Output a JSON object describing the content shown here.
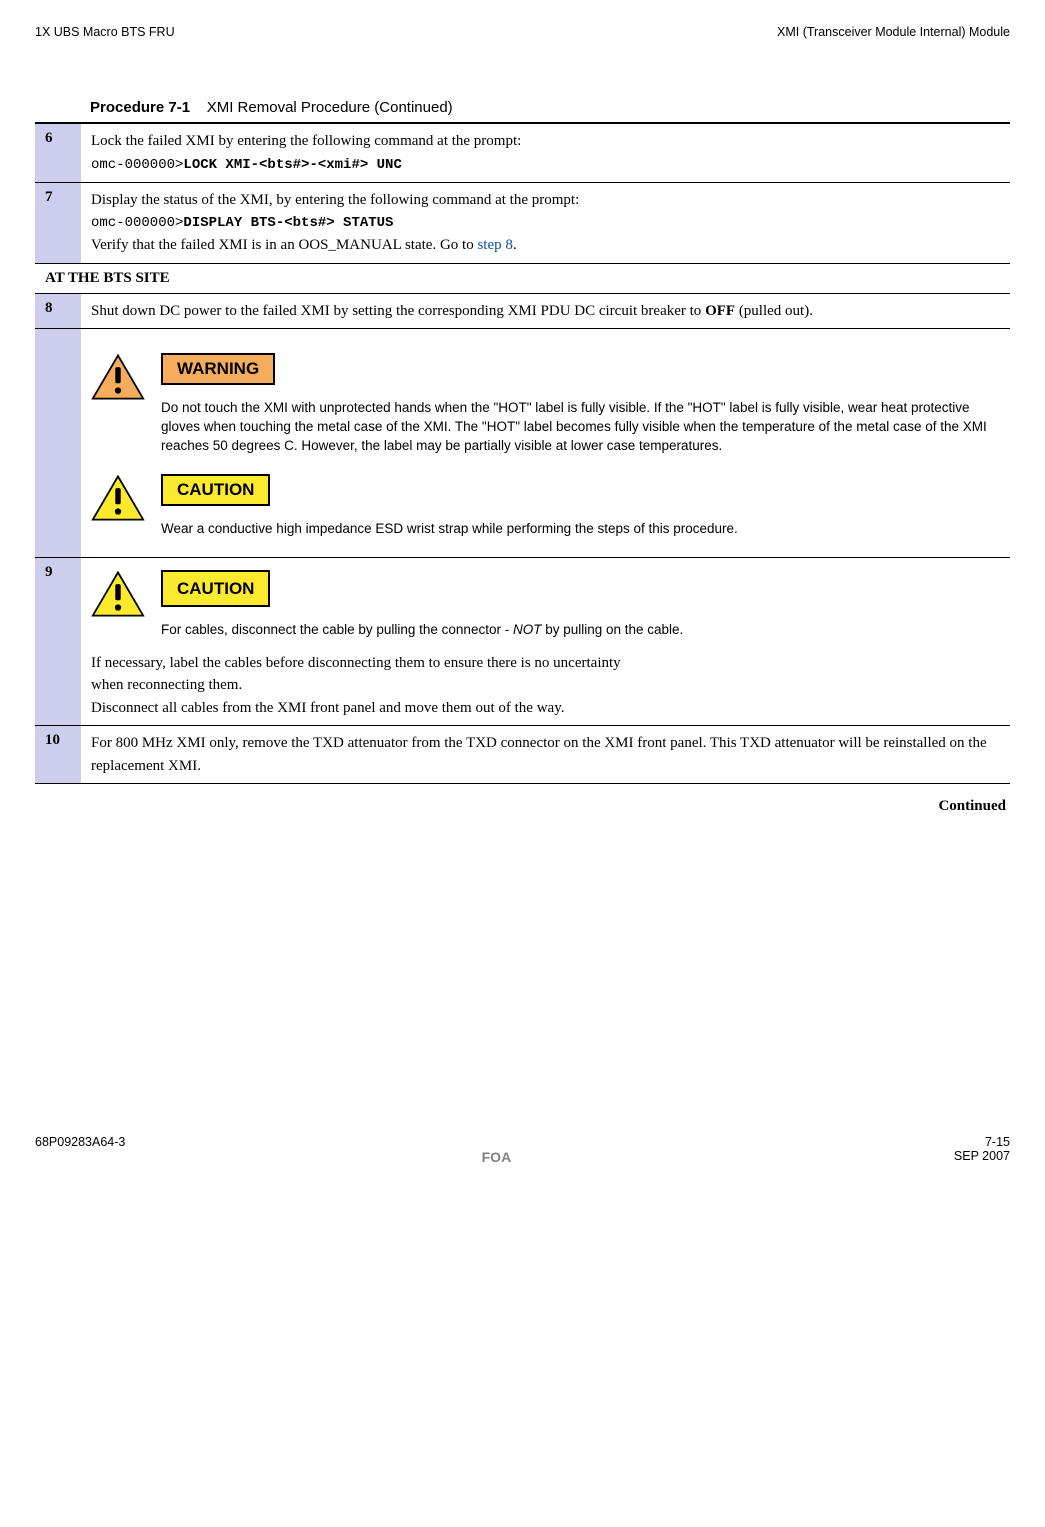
{
  "header": {
    "left": "1X UBS Macro BTS FRU",
    "right": "XMI (Transceiver Module Internal) Module"
  },
  "procedure": {
    "label": "Procedure 7-1",
    "title": "XMI Removal Procedure (Continued)"
  },
  "steps": {
    "s6": {
      "num": "6",
      "text1": "Lock the failed XMI by entering the following command at the prompt:",
      "prompt": "omc-000000>",
      "cmd": "LOCK XMI-<bts#>-<xmi#> UNC"
    },
    "s7": {
      "num": "7",
      "text1": "Display the status of the XMI, by entering the following command at the prompt:",
      "prompt": "omc-000000>",
      "cmd": "DISPLAY BTS-<bts#> STATUS",
      "text2a": "Verify that the failed XMI is in an OOS_MANUAL state.  Go to ",
      "link": "step 8",
      "text2b": "."
    },
    "section": "AT THE BTS SITE",
    "s8": {
      "num": "8",
      "text1a": "Shut down DC power to the failed XMI by setting the corresponding XMI PDU DC circuit breaker to ",
      "bold": "OFF",
      "text1b": " (pulled out)."
    },
    "warn1": {
      "label": "WARNING",
      "body": "Do not touch the XMI with unprotected hands when the \"HOT\" label is fully visible. If the \"HOT\" label is fully visible, wear heat protective gloves when touching the metal case of the XMI. The \"HOT\" label becomes fully visible when the temperature of the metal case of the XMI reaches 50 degrees C. However, the label may be partially visible at lower case temperatures."
    },
    "caution1": {
      "label": "CAUTION",
      "body": "Wear a conductive high impedance ESD wrist strap while performing the steps of this procedure."
    },
    "s9": {
      "num": "9",
      "caution_label": "CAUTION",
      "caution_body_a": "For cables, disconnect the cable by pulling the connector - ",
      "caution_body_em": "NOT",
      "caution_body_b": " by pulling on the cable.",
      "para1": "If necessary, label the cables before disconnecting them to ensure there is no uncertainty when reconnecting them.",
      "para2": "Disconnect all cables from the XMI front panel and move them out of the way."
    },
    "s10": {
      "num": "10",
      "text": "For 800 MHz XMI only, remove the TXD attenuator from the TXD connector on the XMI front panel. This TXD attenuator will be reinstalled on the replacement XMI."
    }
  },
  "continued": "Continued",
  "footer": {
    "docnum": "68P09283A64-3",
    "page": "7-15",
    "foa": "FOA",
    "date": "SEP 2007"
  }
}
